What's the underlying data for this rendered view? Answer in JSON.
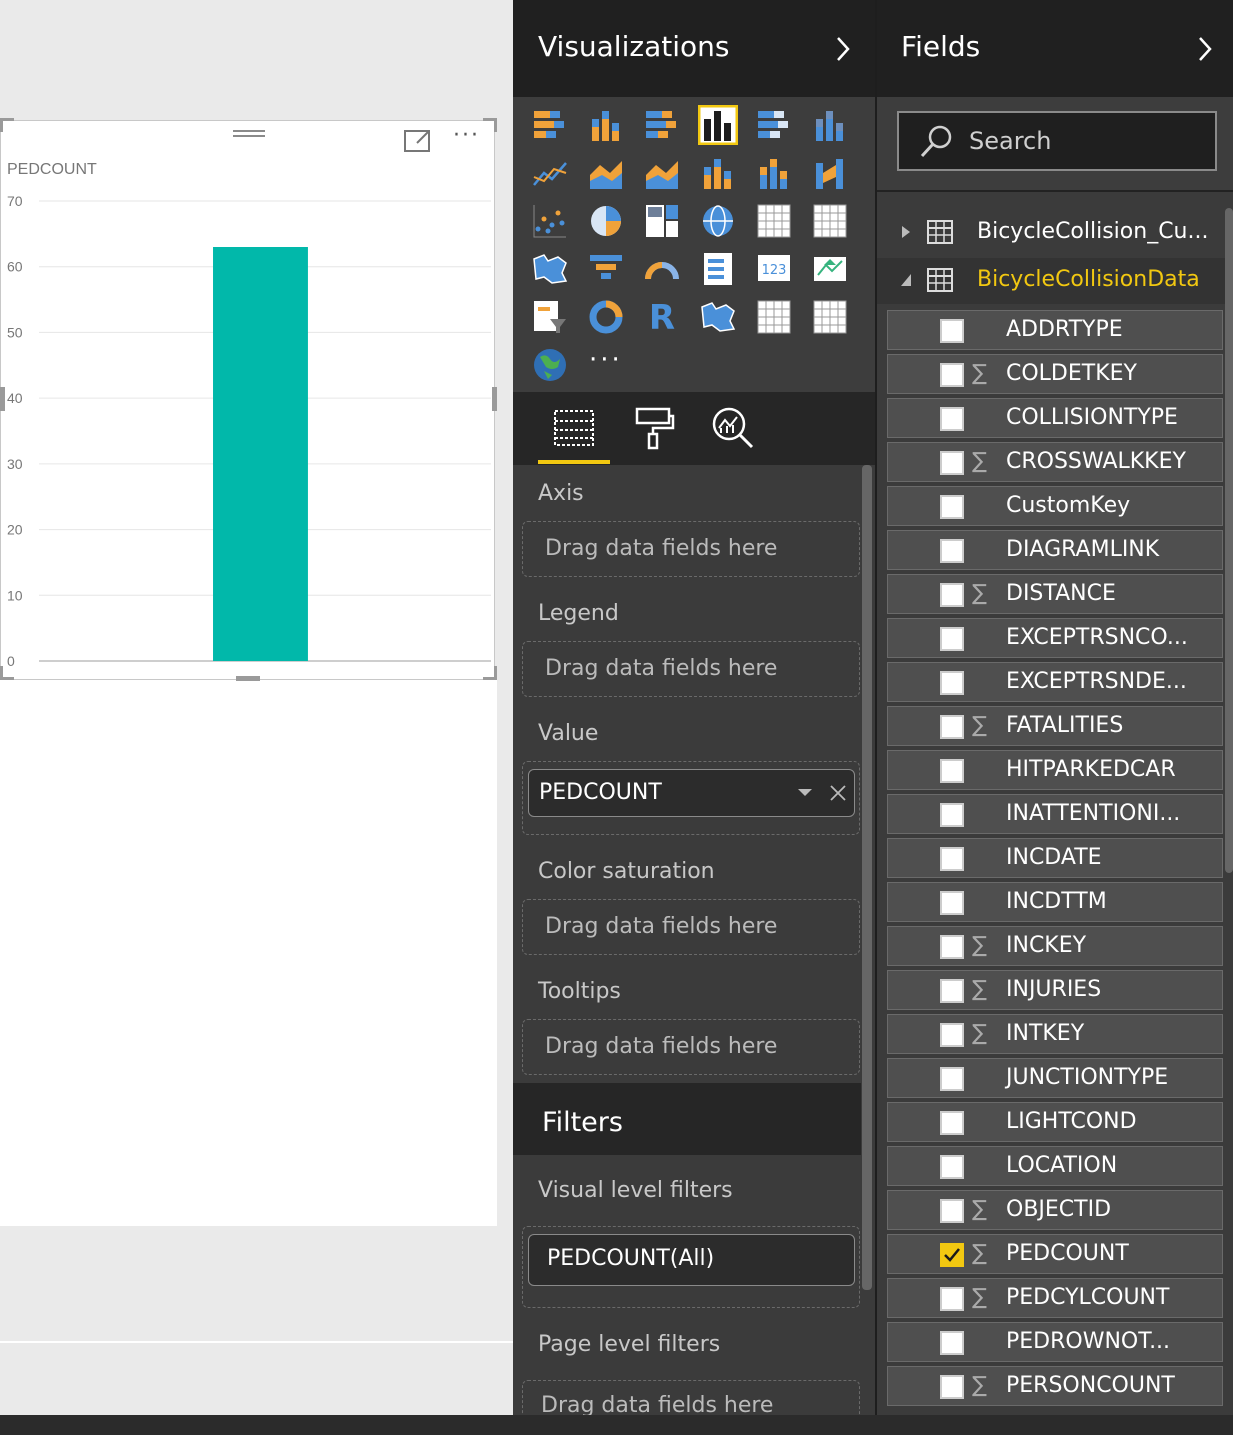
{
  "colors": {
    "accent": "#f2c811",
    "bar": "#01b8aa",
    "pane_bg": "#3b3b3b",
    "header_bg": "#202020"
  },
  "visual": {
    "title": "PEDCOUNT",
    "more_label": "···"
  },
  "chart_data": {
    "type": "bar",
    "title": "PEDCOUNT",
    "categories": [
      ""
    ],
    "values": [
      63
    ],
    "ylim": [
      0,
      70
    ],
    "yticks": [
      "0",
      "10",
      "20",
      "30",
      "40",
      "50",
      "60",
      "70"
    ],
    "grid": true,
    "legend": "none",
    "xlabel": "",
    "ylabel": ""
  },
  "visualizations": {
    "title": "Visualizations",
    "gallery": [
      "stacked-bar-chart-icon",
      "stacked-column-chart-icon",
      "clustered-bar-chart-icon",
      "clustered-column-chart-icon",
      "100-stacked-bar-chart-icon",
      "100-stacked-column-chart-icon",
      "line-chart-icon",
      "area-chart-icon",
      "stacked-area-chart-icon",
      "line-and-stacked-column-icon",
      "line-and-clustered-column-icon",
      "ribbon-chart-icon",
      "scatter-chart-icon",
      "pie-chart-icon",
      "treemap-icon",
      "map-icon",
      "table-icon",
      "matrix-icon",
      "filled-map-icon",
      "funnel-icon",
      "gauge-icon",
      "multi-row-card-icon",
      "card-icon",
      "kpi-icon",
      "slicer-icon",
      "donut-chart-icon",
      "r-visual-icon",
      "shape-map-icon",
      "custom-table-icon",
      "custom-matrix-icon",
      "globe-map-icon"
    ],
    "more_label": "···",
    "tabs": [
      "fields-tab-icon",
      "format-tab-icon",
      "analytics-tab-icon"
    ],
    "wells": {
      "axis": {
        "label": "Axis",
        "placeholder": "Drag data fields here"
      },
      "legend": {
        "label": "Legend",
        "placeholder": "Drag data fields here"
      },
      "value": {
        "label": "Value",
        "field": "PEDCOUNT"
      },
      "color_saturation": {
        "label": "Color saturation",
        "placeholder": "Drag data fields here"
      },
      "tooltips": {
        "label": "Tooltips",
        "placeholder": "Drag data fields here"
      }
    },
    "filters": {
      "title": "Filters",
      "visual_level_label": "Visual level filters",
      "visual_level_filter": "PEDCOUNT(All)",
      "page_level_label": "Page level filters",
      "page_level_placeholder": "Drag data fields here"
    }
  },
  "fields": {
    "title": "Fields",
    "search_placeholder": "Search",
    "tables": [
      {
        "name": "BicycleCollision_Cu...",
        "expanded": false,
        "selected": false
      },
      {
        "name": "BicycleCollisionData",
        "expanded": true,
        "selected": true
      }
    ],
    "items": [
      {
        "name": "ADDRTYPE",
        "sigma": false,
        "checked": false
      },
      {
        "name": "COLDETKEY",
        "sigma": true,
        "checked": false
      },
      {
        "name": "COLLISIONTYPE",
        "sigma": false,
        "checked": false
      },
      {
        "name": "CROSSWALKKEY",
        "sigma": true,
        "checked": false
      },
      {
        "name": "CustomKey",
        "sigma": false,
        "checked": false
      },
      {
        "name": "DIAGRAMLINK",
        "sigma": false,
        "checked": false
      },
      {
        "name": "DISTANCE",
        "sigma": true,
        "checked": false
      },
      {
        "name": "EXCEPTRSNCO...",
        "sigma": false,
        "checked": false
      },
      {
        "name": "EXCEPTRSNDE...",
        "sigma": false,
        "checked": false
      },
      {
        "name": "FATALITIES",
        "sigma": true,
        "checked": false
      },
      {
        "name": "HITPARKEDCAR",
        "sigma": false,
        "checked": false
      },
      {
        "name": "INATTENTIONI...",
        "sigma": false,
        "checked": false
      },
      {
        "name": "INCDATE",
        "sigma": false,
        "checked": false
      },
      {
        "name": "INCDTTM",
        "sigma": false,
        "checked": false
      },
      {
        "name": "INCKEY",
        "sigma": true,
        "checked": false
      },
      {
        "name": "INJURIES",
        "sigma": true,
        "checked": false
      },
      {
        "name": "INTKEY",
        "sigma": true,
        "checked": false
      },
      {
        "name": "JUNCTIONTYPE",
        "sigma": false,
        "checked": false
      },
      {
        "name": "LIGHTCOND",
        "sigma": false,
        "checked": false
      },
      {
        "name": "LOCATION",
        "sigma": false,
        "checked": false
      },
      {
        "name": "OBJECTID",
        "sigma": true,
        "checked": false
      },
      {
        "name": "PEDCOUNT",
        "sigma": true,
        "checked": true
      },
      {
        "name": "PEDCYLCOUNT",
        "sigma": true,
        "checked": false
      },
      {
        "name": "PEDROWNOT...",
        "sigma": false,
        "checked": false
      },
      {
        "name": "PERSONCOUNT",
        "sigma": true,
        "checked": false
      }
    ]
  }
}
